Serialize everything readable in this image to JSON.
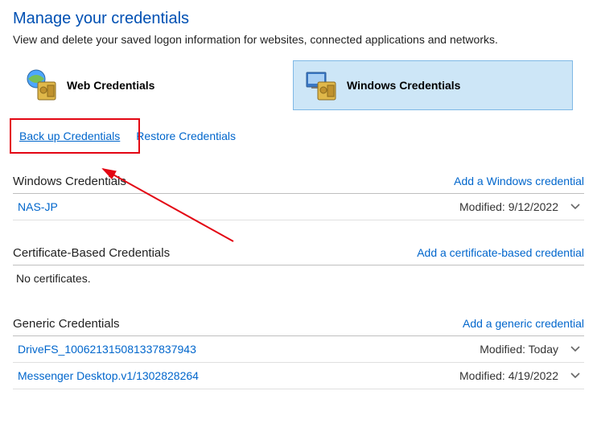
{
  "page": {
    "title": "Manage your credentials",
    "description": "View and delete your saved logon information for websites, connected applications and networks."
  },
  "tabs": {
    "web": {
      "label": "Web Credentials",
      "icon": "web-vault-icon"
    },
    "windows": {
      "label": "Windows Credentials",
      "icon": "windows-vault-icon",
      "active": true
    }
  },
  "links": {
    "backup": "Back up Credentials",
    "restore": "Restore Credentials"
  },
  "sections": {
    "windows": {
      "title": "Windows Credentials",
      "add": "Add a Windows credential",
      "rows": [
        {
          "name": "NAS-JP",
          "modified_label": "Modified:",
          "modified_value": "9/12/2022"
        }
      ]
    },
    "cert": {
      "title": "Certificate-Based Credentials",
      "add": "Add a certificate-based credential",
      "empty": "No certificates."
    },
    "generic": {
      "title": "Generic Credentials",
      "add": "Add a generic credential",
      "rows": [
        {
          "name": "DriveFS_100621315081337837943",
          "modified_label": "Modified:",
          "modified_value": "Today"
        },
        {
          "name": "Messenger Desktop.v1/1302828264",
          "modified_label": "Modified:",
          "modified_value": "4/19/2022"
        }
      ]
    }
  }
}
